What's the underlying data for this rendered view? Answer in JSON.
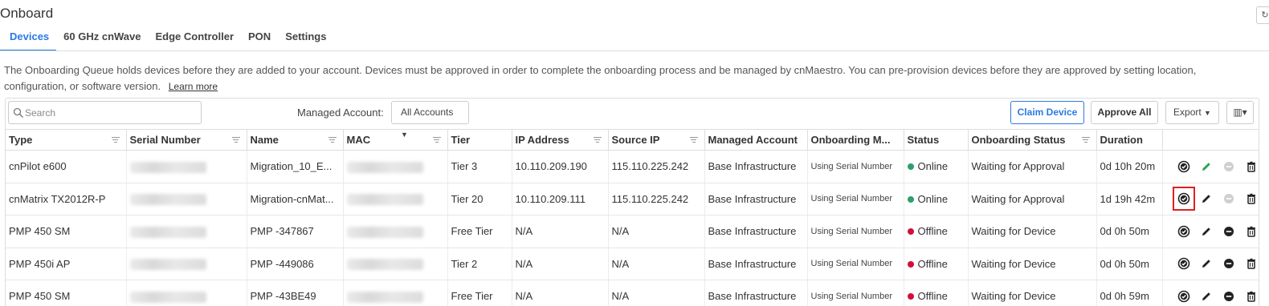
{
  "page": {
    "title": "Onboard"
  },
  "tabs": [
    {
      "label": "Devices",
      "active": true
    },
    {
      "label": "60 GHz cnWave",
      "active": false
    },
    {
      "label": "Edge Controller",
      "active": false
    },
    {
      "label": "PON",
      "active": false
    },
    {
      "label": "Settings",
      "active": false
    }
  ],
  "description": {
    "text": "The Onboarding Queue holds devices before they are added to your account. Devices must be approved in order to complete the onboarding process and be managed by cnMaestro. You can pre-provision devices before they are approved by setting location, configuration, or software version.",
    "learn_more": "Learn more"
  },
  "toolbar": {
    "search_placeholder": "Search",
    "managed_account_label": "Managed Account:",
    "managed_account_value": "All Accounts",
    "claim_label": "Claim Device",
    "approve_all_label": "Approve All",
    "export_label": "Export"
  },
  "table": {
    "headers": [
      "Type",
      "Serial Number",
      "Name",
      "MAC",
      "Tier",
      "IP Address",
      "Source IP",
      "Managed Account",
      "Onboarding M...",
      "Status",
      "Onboarding Status",
      "Duration",
      ""
    ],
    "rows": [
      {
        "type": "cnPilot e600",
        "name": "Migration_10_E...",
        "tier": "Tier 3",
        "ip": "10.110.209.190",
        "source_ip": "115.110.225.242",
        "account": "Base Infrastructure",
        "method": "Using Serial Number",
        "status": "Online",
        "onboarding_status": "Waiting for Approval",
        "duration": "0d 10h 20m"
      },
      {
        "type": "cnMatrix TX2012R-P",
        "name": "Migration-cnMat...",
        "tier": "Tier 20",
        "ip": "10.110.209.111",
        "source_ip": "115.110.225.242",
        "account": "Base Infrastructure",
        "method": "Using Serial Number",
        "status": "Online",
        "onboarding_status": "Waiting for Approval",
        "duration": "1d 19h 42m"
      },
      {
        "type": "PMP 450 SM",
        "name": "PMP -347867",
        "tier": "Free Tier",
        "ip": "N/A",
        "source_ip": "N/A",
        "account": "Base Infrastructure",
        "method": "Using Serial Number",
        "status": "Offline",
        "onboarding_status": "Waiting for Device",
        "duration": "0d 0h 50m"
      },
      {
        "type": "PMP 450i AP",
        "name": "PMP -449086",
        "tier": "Tier 2",
        "ip": "N/A",
        "source_ip": "N/A",
        "account": "Base Infrastructure",
        "method": "Using Serial Number",
        "status": "Offline",
        "onboarding_status": "Waiting for Device",
        "duration": "0d 0h 50m"
      },
      {
        "type": "PMP 450 SM",
        "name": "PMP -43BE49",
        "tier": "Free Tier",
        "ip": "N/A",
        "source_ip": "N/A",
        "account": "Base Infrastructure",
        "method": "Using Serial Number",
        "status": "Offline",
        "onboarding_status": "Waiting for Device",
        "duration": "0d 0h 59m"
      }
    ]
  },
  "colors": {
    "accent": "#2a7ae2",
    "online": "#2e9e6b",
    "offline": "#d0103a",
    "highlight": "#e02020"
  },
  "icons": [
    "search-icon",
    "approve-icon",
    "edit-icon",
    "remove-icon",
    "delete-icon",
    "caret-down-icon",
    "columns-icon",
    "filter-icon",
    "refresh-icon"
  ]
}
